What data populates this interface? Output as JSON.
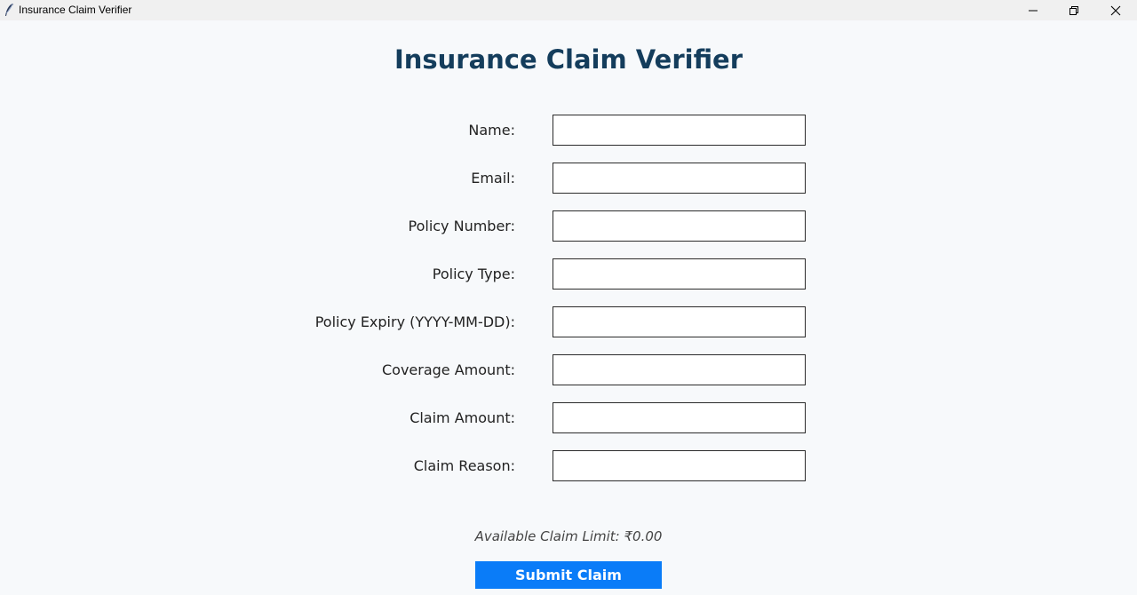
{
  "window": {
    "title": "Insurance Claim Verifier",
    "controls": [
      "minimize-icon",
      "restore-icon",
      "close-icon"
    ]
  },
  "heading": "Insurance Claim Verifier",
  "form": {
    "fields": [
      {
        "label": "Name:",
        "value": ""
      },
      {
        "label": "Email:",
        "value": ""
      },
      {
        "label": "Policy Number:",
        "value": ""
      },
      {
        "label": "Policy Type:",
        "value": ""
      },
      {
        "label": "Policy Expiry (YYYY-MM-DD):",
        "value": ""
      },
      {
        "label": "Coverage Amount:",
        "value": ""
      },
      {
        "label": "Claim Amount:",
        "value": ""
      },
      {
        "label": "Claim Reason:",
        "value": ""
      }
    ]
  },
  "claim_limit_text": "Available Claim Limit: ₹0.00",
  "submit_label": "Submit Claim",
  "colors": {
    "heading": "#143d5c",
    "button_bg": "#0a7cf8",
    "button_text": "#ffffff",
    "background": "#f7f9fb"
  }
}
